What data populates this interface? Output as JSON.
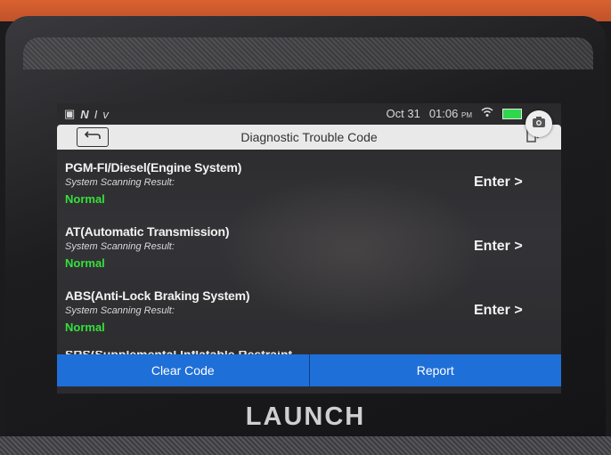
{
  "device": {
    "brand": "LAUNCH"
  },
  "status_bar": {
    "left_icons": [
      "▣",
      "N",
      "I",
      "v"
    ],
    "date": "Oct 31",
    "time": "01:06",
    "ampm": "PM"
  },
  "header": {
    "title": "Diagnostic Trouble Code"
  },
  "systems": [
    {
      "name": "PGM-FI/Diesel(Engine System)",
      "label": "System Scanning Result:",
      "status": "Normal",
      "action": "Enter >"
    },
    {
      "name": "AT(Automatic Transmission)",
      "label": "System Scanning Result:",
      "status": "Normal",
      "action": "Enter >"
    },
    {
      "name": "ABS(Anti-Lock Braking System)",
      "label": "System Scanning Result:",
      "status": "Normal",
      "action": "Enter >"
    }
  ],
  "partial_item": {
    "name": "SRS(Supplemental Inflatable Restraint System)"
  },
  "footer": {
    "clear_code": "Clear Code",
    "report": "Report"
  },
  "colors": {
    "status_normal": "#35e03a",
    "footer_button": "#1f6fd8",
    "accent_device": "#d9612f"
  }
}
